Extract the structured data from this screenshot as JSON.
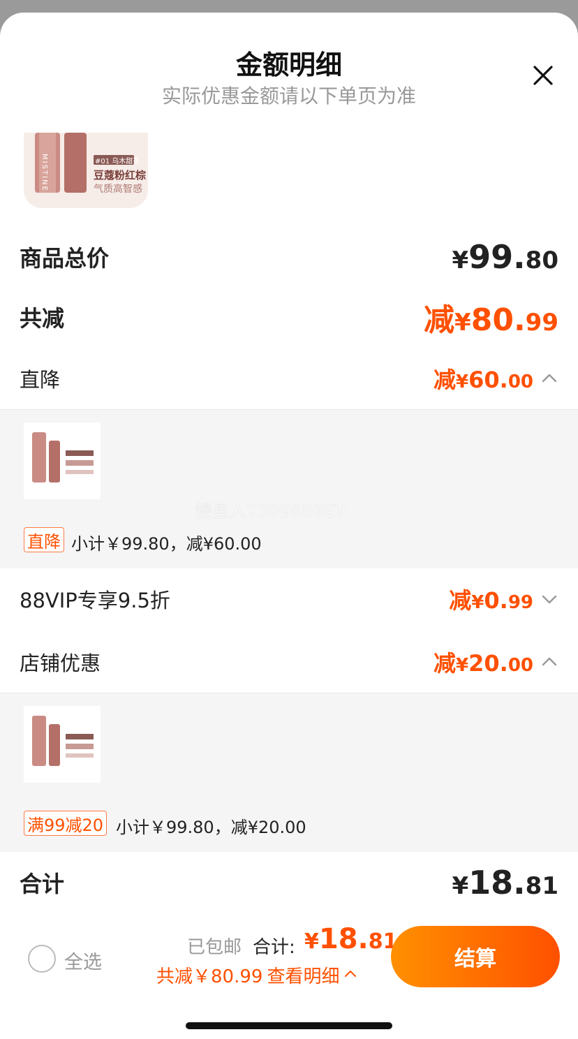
{
  "header": {
    "title": "金额明细",
    "subtitle": "实际优惠金额请以下单页为准",
    "close_icon": "close-icon"
  },
  "product": {
    "image_tag": "#01 乌木甜茶",
    "image_line1": "豆蔻粉红棕",
    "image_line2": "气质高智感",
    "brand": "MISTINE"
  },
  "summary": {
    "total_label": "商品总价",
    "total_sym": "¥",
    "total_int": "99.",
    "total_dec": "80",
    "discount_label": "共减",
    "discount_prefix": "减",
    "discount_sym": "¥",
    "discount_int": "80.",
    "discount_dec": "99"
  },
  "sections": {
    "direct": {
      "label": "直降",
      "prefix": "减",
      "sym": "¥",
      "int": "60.",
      "dec": "00",
      "tag": "直降",
      "subtotal": "小计￥99.80，减¥60.00"
    },
    "vip": {
      "label": "88VIP专享9.5折",
      "prefix": "减",
      "sym": "¥",
      "int": "0.",
      "dec": "99"
    },
    "store": {
      "label": "店铺优惠",
      "prefix": "减",
      "sym": "¥",
      "int": "20.",
      "dec": "00",
      "tag": "满99减20",
      "subtotal": "小计￥99.80，减¥20.00"
    }
  },
  "grand_total": {
    "label": "合计",
    "sym": "¥",
    "int": "18.",
    "dec": "81"
  },
  "watermark": "慢星人7309886ET",
  "bottom_bar": {
    "select_all": "全选",
    "shipping": "已包邮",
    "total_label": "合计:",
    "total_sym": "¥",
    "total_int": "18.",
    "total_dec": "81",
    "discount_text": "共减￥80.99",
    "detail_link": "查看明细",
    "checkout": "结算"
  },
  "colors": {
    "accent": "#ff5000",
    "accent_gradient_start": "#ff9000",
    "muted": "#999999"
  }
}
